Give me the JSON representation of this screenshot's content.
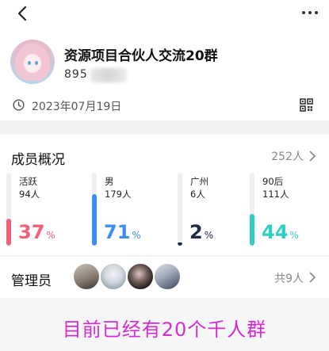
{
  "header": {
    "group_name": "资源项目合伙人交流20群",
    "group_id_visible": "895",
    "created_date": "2023年07月19日"
  },
  "icons": {
    "back": "back-arrow-icon",
    "more": "more-dots-icon",
    "date": "clock-icon",
    "qr": "qr-code-icon"
  },
  "members": {
    "title": "成员概况",
    "total": "252人",
    "stats": [
      {
        "label": "活跃",
        "sub": "94人",
        "percent": "37",
        "unit": "%",
        "fraction": 0.37,
        "color": "#f0607a"
      },
      {
        "label": "男",
        "sub": "179人",
        "percent": "71",
        "unit": "%",
        "fraction": 0.71,
        "color": "#3d8ef2"
      },
      {
        "label": "广州",
        "sub": "6人",
        "percent": "2",
        "unit": "%",
        "fraction": 0.02,
        "color": "#1f2a44"
      },
      {
        "label": "90后",
        "sub": "111人",
        "percent": "44",
        "unit": "%",
        "fraction": 0.44,
        "color": "#2fd0c0"
      }
    ]
  },
  "admins": {
    "title": "管理员",
    "count": "共9人"
  },
  "banner": {
    "text": "目前已经有20个千人群"
  }
}
